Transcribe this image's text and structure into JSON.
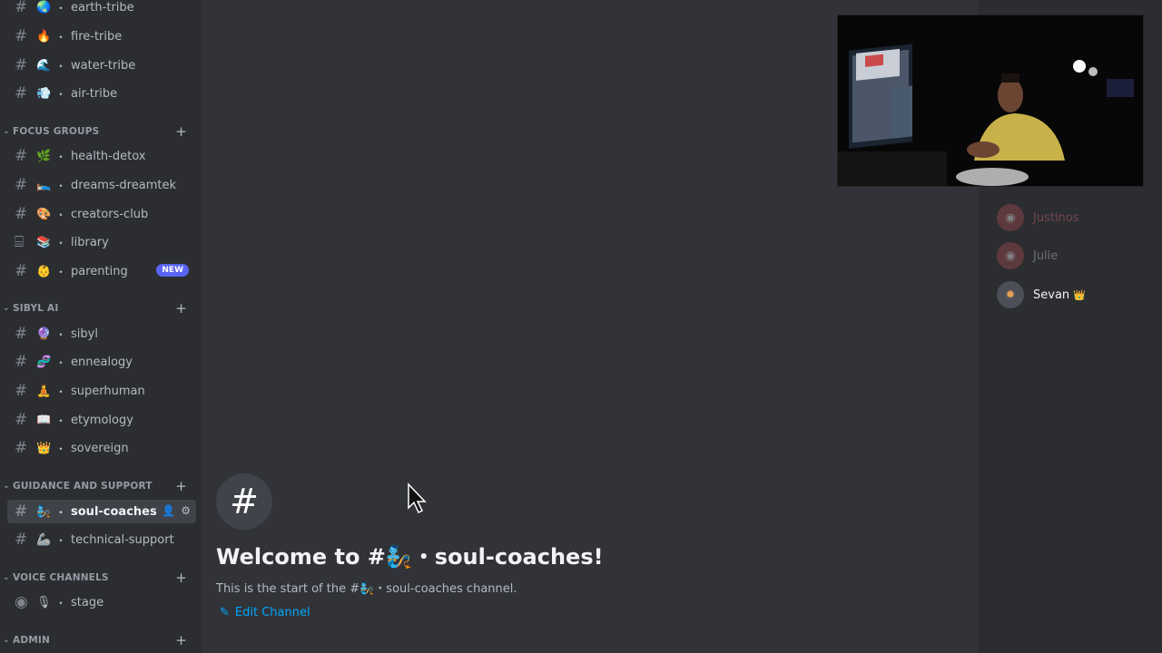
{
  "sidebar": {
    "channels_top": [
      {
        "emoji": "🌏",
        "label": "earth-tribe"
      },
      {
        "emoji": "🔥",
        "label": "fire-tribe"
      },
      {
        "emoji": "🌊",
        "label": "water-tribe"
      },
      {
        "emoji": "💨",
        "label": "air-tribe"
      }
    ],
    "categories": {
      "focus_groups": "FOCUS GROUPS",
      "sibyl_ai": "SIBYL AI",
      "guidance": "GUIDANCE AND SUPPORT",
      "voice": "VOICE CHANNELS",
      "admin": "ADMIN"
    },
    "focus_groups": [
      {
        "emoji": "🌿",
        "label": "health-detox"
      },
      {
        "emoji": "🛌",
        "label": "dreams-dreamtek"
      },
      {
        "emoji": "🎨",
        "label": "creators-club"
      },
      {
        "emoji": "📚",
        "label": "library"
      },
      {
        "emoji": "👶",
        "label": "parenting",
        "badge": "NEW"
      }
    ],
    "sibyl_ai": [
      {
        "emoji": "🔮",
        "label": "sibyl"
      },
      {
        "emoji": "🧬",
        "label": "ennealogy"
      },
      {
        "emoji": "🧘",
        "label": "superhuman"
      },
      {
        "emoji": "📖",
        "label": "etymology"
      },
      {
        "emoji": "👑",
        "label": "sovereign"
      }
    ],
    "guidance": [
      {
        "emoji": "🧞",
        "label": "soul-coaches",
        "active": true
      },
      {
        "emoji": "🦾",
        "label": "technical-support"
      }
    ],
    "voice": [
      {
        "emoji": "🎙",
        "label": "stage"
      }
    ]
  },
  "main": {
    "welcome_icon": "#",
    "welcome_title": "Welcome to #🧞・soul-coaches!",
    "welcome_sub": "This is the start of the #🧞・soul-coaches channel.",
    "edit_channel": "Edit Channel"
  },
  "members": [
    {
      "name": "Justinos",
      "dim": true
    },
    {
      "name": "Julie",
      "dim": true
    },
    {
      "name": "Sevan",
      "crown": "👑"
    }
  ],
  "colors": {
    "accent": "#5865f2",
    "link": "#00a8fc",
    "background": "#313338",
    "sidebar": "#2b2d31"
  }
}
